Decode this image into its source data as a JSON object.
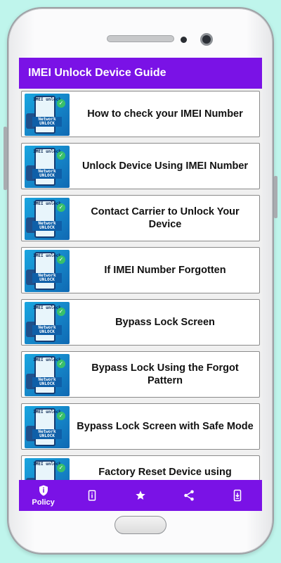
{
  "app": {
    "title": "IMEI Unlock Device Guide"
  },
  "thumbnail": {
    "line1": "IMEI unlock",
    "line2": "Network UNLOCK"
  },
  "items": [
    {
      "label": "How to check your IMEI Number"
    },
    {
      "label": "Unlock Device Using IMEI Number"
    },
    {
      "label": "Contact Carrier to Unlock Your Device"
    },
    {
      "label": "If IMEI Number Forgotten"
    },
    {
      "label": "Bypass Lock Screen"
    },
    {
      "label": "Bypass Lock Using the Forgot Pattern"
    },
    {
      "label": "Bypass Lock Screen with Safe Mode"
    },
    {
      "label": "Factory Reset Device using Recovery"
    }
  ],
  "bottom_nav": [
    {
      "icon": "shield-icon",
      "label": "Policy"
    },
    {
      "icon": "info-icon"
    },
    {
      "icon": "star-icon"
    },
    {
      "icon": "share-icon"
    },
    {
      "icon": "download-phone-icon"
    }
  ],
  "colors": {
    "accent": "#7a12e6",
    "background": "#bff5ec"
  }
}
